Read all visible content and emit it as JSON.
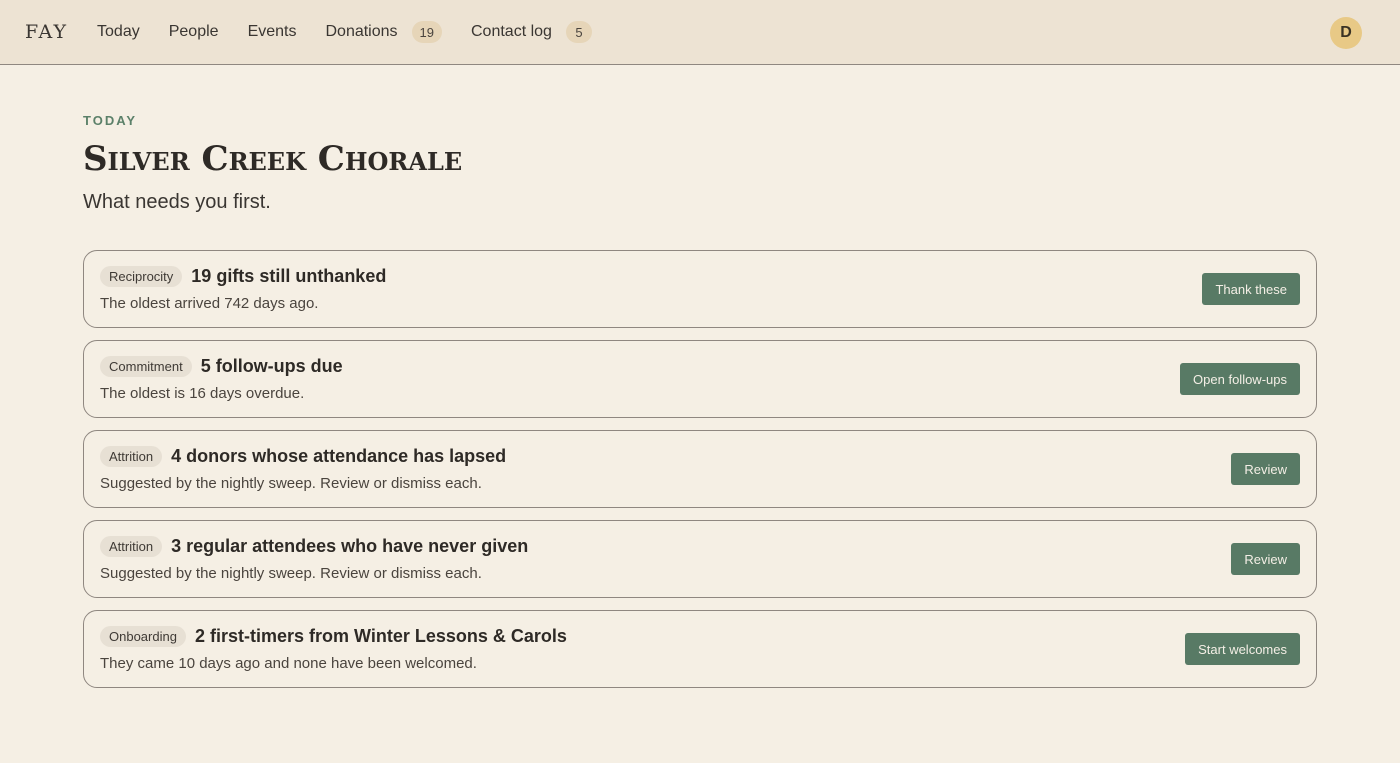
{
  "app": {
    "logo": "FAY"
  },
  "nav": {
    "items": [
      {
        "label": "Today",
        "badge": null
      },
      {
        "label": "People",
        "badge": null
      },
      {
        "label": "Events",
        "badge": null
      },
      {
        "label": "Donations",
        "badge": "19"
      },
      {
        "label": "Contact log",
        "badge": "5"
      }
    ]
  },
  "user": {
    "initial": "D"
  },
  "page": {
    "eyebrow": "TODAY",
    "title": "Silver Creek Chorale",
    "subtitle": "What needs you first."
  },
  "cards": [
    {
      "tag": "Reciprocity",
      "title": "19 gifts still unthanked",
      "desc": "The oldest arrived 742 days ago.",
      "action": "Thank these"
    },
    {
      "tag": "Commitment",
      "title": "5 follow-ups due",
      "desc": "The oldest is 16 days overdue.",
      "action": "Open follow-ups"
    },
    {
      "tag": "Attrition",
      "title": "4 donors whose attendance has lapsed",
      "desc": "Suggested by the nightly sweep. Review or dismiss each.",
      "action": "Review"
    },
    {
      "tag": "Attrition",
      "title": "3 regular attendees who have never given",
      "desc": "Suggested by the nightly sweep. Review or dismiss each.",
      "action": "Review"
    },
    {
      "tag": "Onboarding",
      "title": "2 first-timers from Winter Lessons & Carols",
      "desc": "They came 10 days ago and none have been welcomed.",
      "action": "Start welcomes"
    }
  ],
  "colors": {
    "accent": "#587a65",
    "background": "#f5efe4",
    "topbar": "#ede3d3",
    "badge": "#e6d5b8",
    "avatar": "#e8c986"
  }
}
